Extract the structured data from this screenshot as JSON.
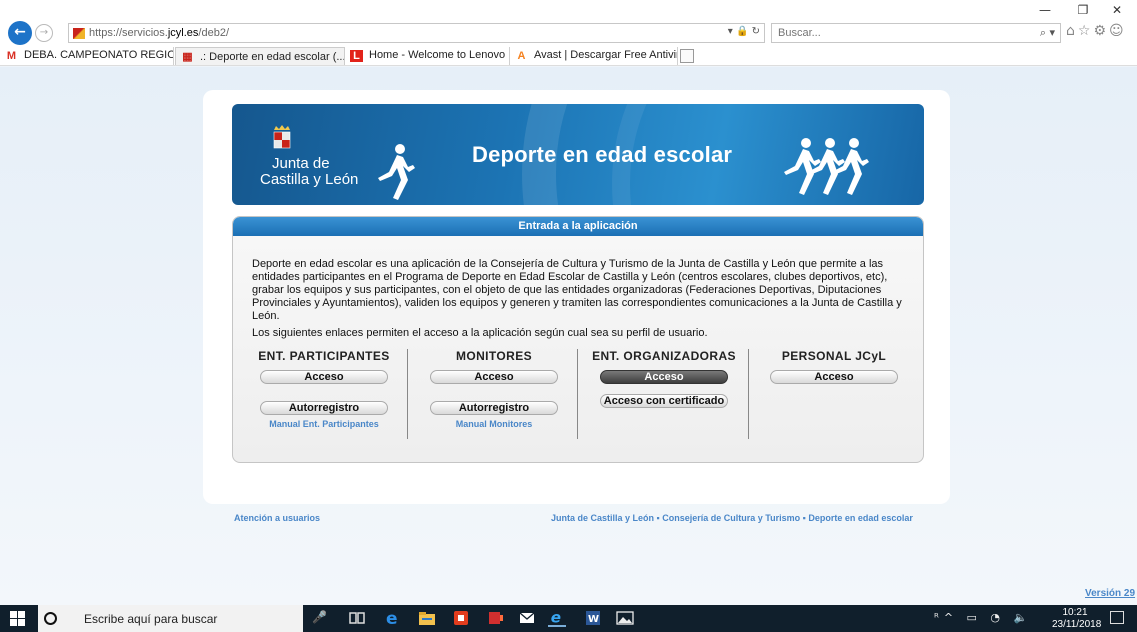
{
  "window": {
    "minimize": "—",
    "restore": "❐",
    "close": "✕"
  },
  "address_bar": {
    "scheme": "https://servicios.",
    "domain": "jcyl.es",
    "path": "/deb2/",
    "controls": "▾ 🔒 ↻",
    "search_placeholder": "Buscar...",
    "search_controls": "⌕ ▾",
    "toolbar_icons": "⌂☆⚙☺"
  },
  "tabs": [
    {
      "label": "DEBA. CAMPEONATO REGION...",
      "icon": "M",
      "icon_color": "#d93025"
    },
    {
      "label": ".: Deporte en edad escolar (...",
      "icon": "▦",
      "icon_color": "#c9231a",
      "close": "✕"
    },
    {
      "label": "Home - Welcome to Lenovo",
      "icon": "L",
      "icon_color": "#e2231a"
    },
    {
      "label": "Avast | Descargar Free Antiviru...",
      "icon": "A",
      "icon_color": "#f58220"
    }
  ],
  "banner": {
    "logo_line1": "Junta de",
    "logo_line2": "Castilla y León",
    "title": "Deporte en edad escolar"
  },
  "panel": {
    "header": "Entrada a la aplicación",
    "description": "Deporte en edad escolar es una aplicación de la Consejería de Cultura y Turismo de la Junta de Castilla y León que permite a las entidades participantes en el Programa de Deporte en Edad Escolar de Castilla y León (centros escolares, clubes deportivos, etc), grabar los equipos y sus participantes, con el objeto de que las entidades organizadoras (Federaciones Deportivas, Diputaciones Provinciales y Ayuntamientos), validen los equipos y generen y tramiten las correspondientes comunicaciones a la Junta de Castilla y León.",
    "links_intro": "Los siguientes enlaces permiten el acceso a la aplicación según cual sea su perfil de usuario.",
    "columns": [
      {
        "title": "ENT. PARTICIPANTES",
        "access": "Acceso",
        "second": "Autorregistro",
        "manual": "Manual Ent. Participantes"
      },
      {
        "title": "MONITORES",
        "access": "Acceso",
        "second": "Autorregistro",
        "manual": "Manual Monitores"
      },
      {
        "title": "ENT. ORGANIZADORAS",
        "access": "Acceso",
        "second": "Acceso con certificado",
        "manual": ""
      },
      {
        "title": "PERSONAL JCyL",
        "access": "Acceso",
        "second": "",
        "manual": ""
      }
    ]
  },
  "footer": {
    "left": "Atención a usuarios",
    "right_links": [
      "Junta de Castilla y León",
      "Consejería de Cultura y Turismo",
      "Deporte en edad escolar"
    ],
    "version": "Versión 29"
  },
  "taskbar": {
    "search_text": "Escribe aquí para buscar",
    "tray": "ᴿ^ ▭ ◔ 🔈",
    "time": "10:21",
    "date": "23/11/2018"
  }
}
